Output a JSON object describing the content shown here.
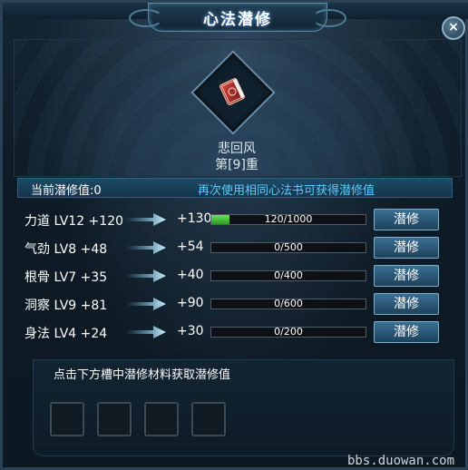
{
  "window": {
    "title": "心法潜修",
    "close_label": "×"
  },
  "skill": {
    "name": "悲回风",
    "tier": "第[9]重"
  },
  "info": {
    "current_label": "当前潜修值:",
    "current_value": "0",
    "hint": "再次使用相同心法书可获得潜修值"
  },
  "stats": [
    {
      "label": "力道 LV12 +120",
      "bonus": "+130",
      "progress_text": "120/1000",
      "progress": 0.12,
      "button": "潜修"
    },
    {
      "label": "气劲 LV8 +48",
      "bonus": "+54",
      "progress_text": "0/500",
      "progress": 0,
      "button": "潜修"
    },
    {
      "label": "根骨 LV7 +35",
      "bonus": "+40",
      "progress_text": "0/400",
      "progress": 0,
      "button": "潜修"
    },
    {
      "label": "洞察 LV9 +81",
      "bonus": "+90",
      "progress_text": "0/600",
      "progress": 0,
      "button": "潜修"
    },
    {
      "label": "身法 LV4 +24",
      "bonus": "+30",
      "progress_text": "0/200",
      "progress": 0,
      "button": "潜修"
    }
  ],
  "materials": {
    "hint": "点击下方槽中潜修材料获取潜修值",
    "slot_count": 4
  },
  "watermark": "bbs.duowan.com",
  "colors": {
    "hint_blue": "#5fcaff",
    "progress_green": "#4cc840"
  },
  "icons": {
    "skill": "book-icon",
    "arrow": "arrow-right-icon",
    "close": "close-icon"
  }
}
